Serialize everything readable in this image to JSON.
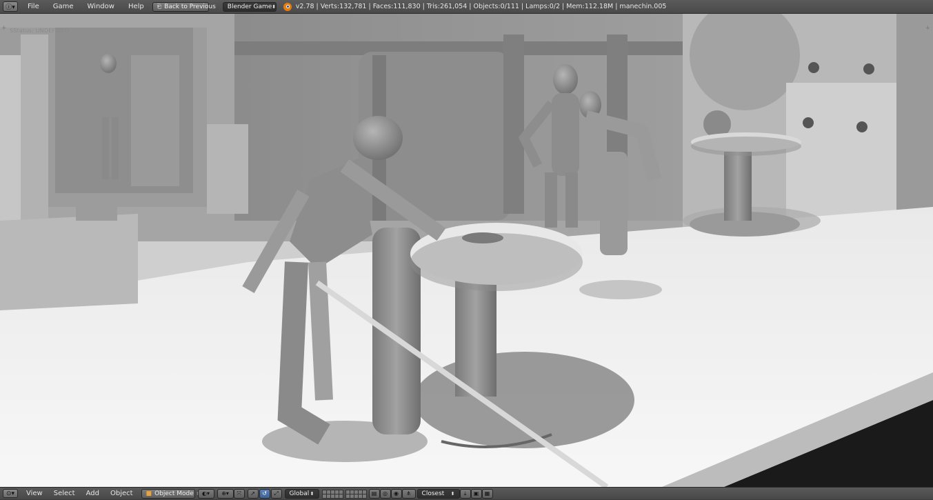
{
  "top_bar": {
    "editor_icon": "info-icon",
    "menus": [
      "File",
      "Game",
      "Window",
      "Help"
    ],
    "back_button": "Back to Previous",
    "engine_select": "Blender Game",
    "stats": "v2.78 | Verts:132,781 | Faces:111,830 | Tris:261,054 | Objects:0/111 | Lamps:0/2 | Mem:112.18M | manechin.005"
  },
  "viewport": {
    "status": "SStatus: UNDEFINED",
    "corner_symbol": "+"
  },
  "bottom_bar": {
    "editor_icon": "3d-view-icon",
    "menus": [
      "View",
      "Select",
      "Add",
      "Object"
    ],
    "mode_select": "Object Mode",
    "orientation_select": "Global",
    "snap_select": "Closest"
  },
  "colors": {
    "header_bg": "#4a4a4a",
    "viewport_floor": "#f2f2f2",
    "viewport_wall": "#8f8f8f",
    "blender_orange": "#e87d0d"
  }
}
